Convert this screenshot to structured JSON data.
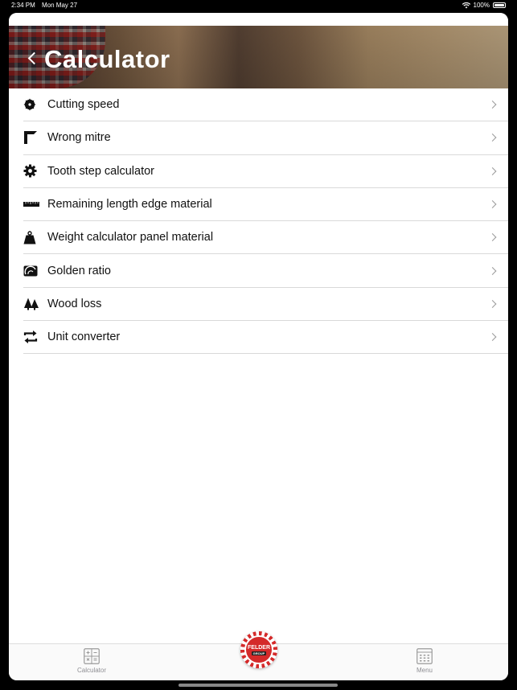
{
  "status": {
    "time": "2:34 PM",
    "date": "Mon May 27",
    "battery": "100%"
  },
  "header": {
    "title": "Calculator"
  },
  "items": [
    {
      "label": "Cutting speed",
      "icon": "saw-blade-icon"
    },
    {
      "label": "Wrong mitre",
      "icon": "mitre-corner-icon"
    },
    {
      "label": "Tooth step calculator",
      "icon": "gear-icon"
    },
    {
      "label": "Remaining length edge material",
      "icon": "ruler-icon"
    },
    {
      "label": "Weight calculator panel material",
      "icon": "weight-icon"
    },
    {
      "label": "Golden ratio",
      "icon": "golden-ratio-icon"
    },
    {
      "label": "Wood loss",
      "icon": "trees-icon"
    },
    {
      "label": "Unit converter",
      "icon": "convert-arrows-icon"
    }
  ],
  "tabbar": {
    "calculator_label": "Calculator",
    "logo_text": "FELDER",
    "logo_sub": "GROUP",
    "menu_label": "Menu"
  }
}
